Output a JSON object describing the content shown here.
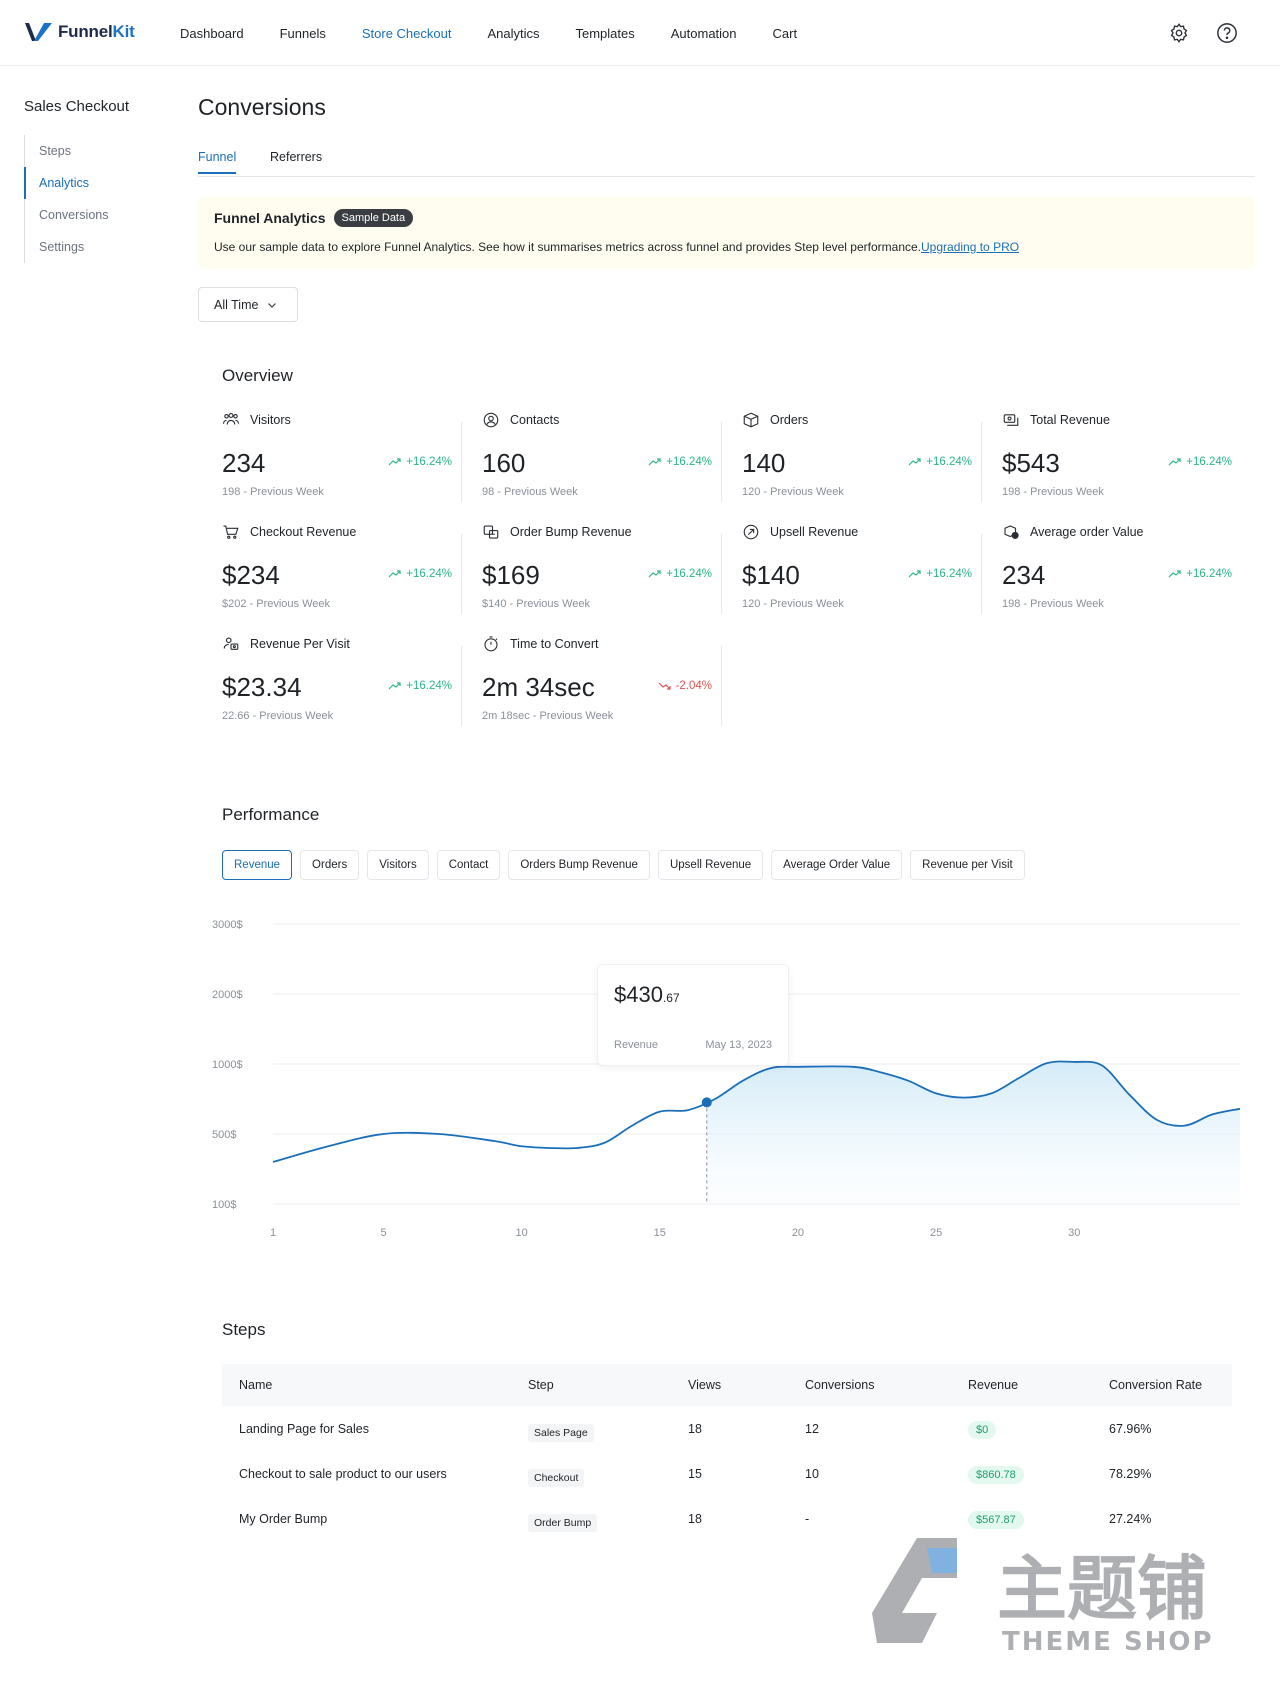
{
  "nav": {
    "brand_a": "Funnel",
    "brand_b": "Kit",
    "items": [
      "Dashboard",
      "Funnels",
      "Store Checkout",
      "Analytics",
      "Templates",
      "Automation",
      "Cart"
    ],
    "active_index": 2
  },
  "sidebar": {
    "title": "Sales Checkout",
    "items": [
      "Steps",
      "Analytics",
      "Conversions",
      "Settings"
    ],
    "active_index": 1
  },
  "page": {
    "title": "Conversions",
    "tabs": [
      "Funnel",
      "Referrers"
    ]
  },
  "banner": {
    "title": "Funnel Analytics",
    "pill": "Sample Data",
    "text": "Use our sample data to explore Funnel Analytics. See how it summarises metrics across funnel and provides Step level performance.",
    "link": "Upgrading to PRO"
  },
  "filter": {
    "value": "All Time"
  },
  "overview": {
    "title": "Overview",
    "metrics": [
      {
        "label": "Visitors",
        "value": "234",
        "change": "+16.24%",
        "prev": "198 - Previous Week",
        "icon": "users-icon",
        "negative": false
      },
      {
        "label": "Contacts",
        "value": "160",
        "change": "+16.24%",
        "prev": "98 - Previous Week",
        "icon": "contacts-icon",
        "negative": false
      },
      {
        "label": "Orders",
        "value": "140",
        "change": "+16.24%",
        "prev": "120 - Previous Week",
        "icon": "box-icon",
        "negative": false
      },
      {
        "label": "Total Revenue",
        "value": "$543",
        "change": "+16.24%",
        "prev": "198 - Previous Week",
        "icon": "revenue-icon",
        "negative": false
      },
      {
        "label": "Checkout Revenue",
        "value": "$234",
        "change": "+16.24%",
        "prev": "$202 - Previous Week",
        "icon": "cart-icon",
        "negative": false
      },
      {
        "label": "Order Bump Revenue",
        "value": "$169",
        "change": "+16.24%",
        "prev": "$140 - Previous Week",
        "icon": "bump-icon",
        "negative": false
      },
      {
        "label": "Upsell Revenue",
        "value": "$140",
        "change": "+16.24%",
        "prev": "120 - Previous Week",
        "icon": "upsell-icon",
        "negative": false
      },
      {
        "label": "Average order Value",
        "value": "234",
        "change": "+16.24%",
        "prev": "198 - Previous Week",
        "icon": "aov-icon",
        "negative": false
      },
      {
        "label": "Revenue Per Visit",
        "value": "$23.34",
        "change": "+16.24%",
        "prev": "22.66 - Previous Week",
        "icon": "visit-revenue-icon",
        "negative": false
      },
      {
        "label": "Time to Convert",
        "value": "2m 34sec",
        "change": "-2.04%",
        "prev": "2m 18sec - Previous Week",
        "icon": "stopwatch-icon",
        "negative": true
      }
    ]
  },
  "performance": {
    "title": "Performance",
    "buttons": [
      "Revenue",
      "Orders",
      "Visitors",
      "Contact",
      "Orders Bump Revenue",
      "Upsell Revenue",
      "Average Order Value",
      "Revenue per Visit"
    ],
    "active_index": 0
  },
  "chart_data": {
    "type": "area",
    "series": [
      {
        "values": [
          [
            1,
            340
          ],
          [
            3,
            430
          ],
          [
            5,
            500
          ],
          [
            7,
            500
          ],
          [
            9,
            460
          ],
          [
            10,
            430
          ],
          [
            11,
            420
          ],
          [
            12,
            420
          ],
          [
            13,
            450
          ],
          [
            14,
            560
          ],
          [
            15,
            660
          ],
          [
            16,
            670
          ],
          [
            17,
            750
          ],
          [
            18,
            880
          ],
          [
            19,
            970
          ],
          [
            20,
            980
          ],
          [
            22,
            980
          ],
          [
            23,
            940
          ],
          [
            24,
            880
          ],
          [
            25,
            790
          ],
          [
            26,
            760
          ],
          [
            27,
            790
          ],
          [
            28,
            900
          ],
          [
            29,
            1010
          ],
          [
            30,
            1030
          ],
          [
            31,
            990
          ],
          [
            32,
            780
          ],
          [
            33,
            600
          ],
          [
            34,
            560
          ],
          [
            35,
            640
          ],
          [
            36,
            680
          ]
        ]
      }
    ],
    "y_ticks": [
      "3000$",
      "2000$",
      "1000$",
      "500$",
      "100$"
    ],
    "x_ticks": [
      "1",
      "5",
      "10",
      "15",
      "20",
      "25",
      "30"
    ],
    "xlim": [
      1,
      36
    ],
    "highlight": {
      "x": 16.7,
      "value_main": "$430",
      "value_cents": ".67",
      "label": "Revenue",
      "date": "May 13, 2023"
    },
    "grid": true,
    "color": "#1b6fb8"
  },
  "steps": {
    "title": "Steps",
    "columns": [
      "Name",
      "Step",
      "Views",
      "Conversions",
      "Revenue",
      "Conversion Rate"
    ],
    "rows": [
      {
        "name": "Landing Page for Sales",
        "step": "Sales Page",
        "views": "18",
        "conversions": "12",
        "revenue": "$0",
        "rate": "67.96%"
      },
      {
        "name": "Checkout to sale product to our users",
        "step": "Checkout",
        "views": "15",
        "conversions": "10",
        "revenue": "$860.78",
        "rate": "78.29%"
      },
      {
        "name": "My Order Bump",
        "step": "Order Bump",
        "views": "18",
        "conversions": "-",
        "revenue": "$567.87",
        "rate": "27.24%"
      }
    ]
  },
  "watermark": {
    "cn": "主题铺",
    "en": "THEME SHOP"
  }
}
